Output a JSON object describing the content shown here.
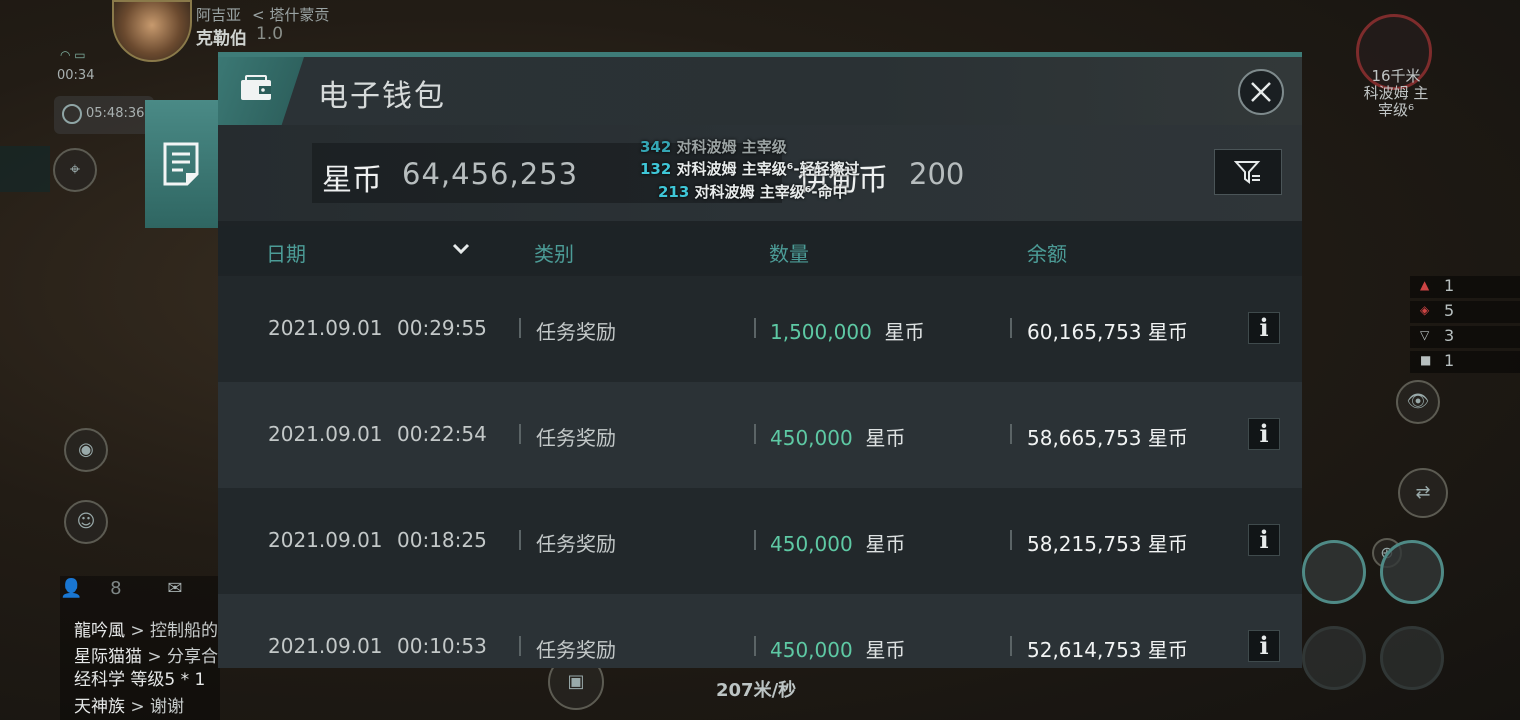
{
  "hud": {
    "pilot_name": "阿吉亚",
    "pilot_corp": "塔什蒙贡",
    "pilot_ship": "克勒伯",
    "pilot_security": "1.0",
    "clock": "00:34",
    "session_timer": "05:48:36",
    "chat_member_count": "8",
    "chat_lines": [
      {
        "user": "龍吟風",
        "msg": "> 控制船的"
      },
      {
        "user": "星际猫猫",
        "msg": "> 分享合"
      },
      {
        "user": "经科学 等级5 * 1",
        "msg": ""
      },
      {
        "user": "天神族",
        "msg": "> 谢谢"
      }
    ],
    "target": {
      "distance": "16千米",
      "name": "科波姆 主",
      "rank": "宰级⁶"
    },
    "counters": [
      "1",
      "5",
      "3",
      "1"
    ],
    "speed": "207米/秒"
  },
  "wallet": {
    "title": "电子钱包",
    "currency1_label": "星币",
    "currency1_value": "64,456,253",
    "currency2_label": "伊甸币",
    "currency2_value": "200",
    "combat_log": [
      {
        "num": "342",
        "text": "对科波姆 主宰级"
      },
      {
        "num": "132",
        "text": "对科波姆 主宰级⁶-轻轻擦过"
      },
      {
        "num": "213",
        "text": "对科波姆 主宰级⁶-命中"
      }
    ],
    "columns": {
      "date": "日期",
      "category": "类别",
      "amount": "数量",
      "balance": "余额"
    },
    "rows": [
      {
        "date": "2021.09.01",
        "time": "00:29:55",
        "category": "任务奖励",
        "amount": "1,500,000",
        "amount_unit": "星币",
        "balance": "60,165,753 星币"
      },
      {
        "date": "2021.09.01",
        "time": "00:22:54",
        "category": "任务奖励",
        "amount": "450,000",
        "amount_unit": "星币",
        "balance": "58,665,753 星币"
      },
      {
        "date": "2021.09.01",
        "time": "00:18:25",
        "category": "任务奖励",
        "amount": "450,000",
        "amount_unit": "星币",
        "balance": "58,215,753 星币"
      },
      {
        "date": "2021.09.01",
        "time": "00:10:53",
        "category": "任务奖励",
        "amount": "450,000",
        "amount_unit": "星币",
        "balance": "52,614,753 星币"
      }
    ],
    "info_glyph": "i"
  },
  "colors": {
    "accent": "#3e7c78",
    "amount_green": "#5ec9a4",
    "header_teal": "#4c9c97",
    "combat_cyan": "#3fc7d8"
  }
}
